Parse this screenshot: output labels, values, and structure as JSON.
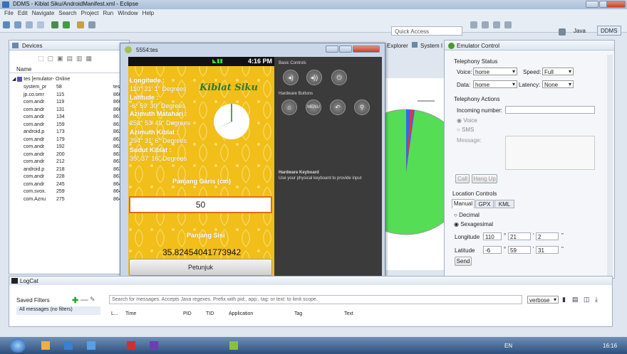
{
  "window": {
    "title": "DDMS - Kiblat Siku/AndroidManifest.xml - Eclipse"
  },
  "menu": [
    "File",
    "Edit",
    "Navigate",
    "Search",
    "Project",
    "Run",
    "Window",
    "Help"
  ],
  "toolbar": {
    "quick_access": "Quick Access",
    "perspectives": [
      "Java",
      "DDMS"
    ]
  },
  "devices": {
    "tab_label": "Devices",
    "col_name": "Name",
    "device": {
      "name": "tes [emulator-",
      "status": "Online"
    },
    "processes": [
      {
        "name": "system_pr",
        "pid": "58",
        "p": "tes"
      },
      {
        "name": "jp.co.omr",
        "pid": "115",
        "p": "860"
      },
      {
        "name": "com.andr",
        "pid": "119",
        "p": "860"
      },
      {
        "name": "com.andr",
        "pid": "131",
        "p": "860"
      },
      {
        "name": "com.andr",
        "pid": "134",
        "p": "861"
      },
      {
        "name": "com.andr",
        "pid": "159",
        "p": "861"
      },
      {
        "name": "android.p",
        "pid": "173",
        "p": "862"
      },
      {
        "name": "com.andr",
        "pid": "179",
        "p": "862"
      },
      {
        "name": "com.andr",
        "pid": "192",
        "p": "862"
      },
      {
        "name": "com.andr",
        "pid": "200",
        "p": "863"
      },
      {
        "name": "com.andr",
        "pid": "212",
        "p": "863"
      },
      {
        "name": "android.p",
        "pid": "218",
        "p": "863"
      },
      {
        "name": "com.andr",
        "pid": "228",
        "p": "863"
      },
      {
        "name": "com.andr",
        "pid": "245",
        "p": "864"
      },
      {
        "name": "com.svox.",
        "pid": "259",
        "p": "864"
      },
      {
        "name": "com.Aznu",
        "pid": "275",
        "p": "864"
      }
    ]
  },
  "emulator": {
    "title": "5554:tes",
    "time": "4:16 PM",
    "longitude_label": "Longitude :",
    "longitude_value": "110° 21' 1\" Degrees",
    "latitude_label": "Latitude :",
    "latitude_value": "-6° 59' 30\" Degrees",
    "azimuth_matahari_label": "Azimuth Matahari :",
    "azimuth_matahari_value": "258° 53' 49\" Degrees",
    "azimuth_kiblat_label": "Azimuth Kiblat :",
    "azimuth_kiblat_value": "294° 31' 6\" Degrees",
    "sudut_kiblat_label": "Sudut Kiblat :",
    "sudut_kiblat_value": "35° 37' 16\" Degrees",
    "logo_text": "Kiblat Siku",
    "panjang_garis_label": "Panjang Garis (cm)",
    "panjang_garis_value": "50",
    "panjang_sisi_label": "Panjang Sisi",
    "panjang_sisi_value": "35.82454041773942",
    "petunjuk_button": "Petunjuk",
    "basic_controls": "Basic Controls",
    "hardware_buttons": "Hardware Buttons",
    "menu_label": "MENU",
    "hw_keyboard_title": "Hardware Keyboard",
    "hw_keyboard_text": "Use your physical keyboard to provide input"
  },
  "file_explorer_tab": "Explorer",
  "system_tab": "System I",
  "emulator_control": {
    "tab_label": "Emulator Control",
    "telephony_status": "Telephony Status",
    "voice_label": "Voice:",
    "voice_value": "home",
    "speed_label": "Speed:",
    "speed_value": "Full",
    "data_label": "Data:",
    "data_value": "home",
    "latency_label": "Latency:",
    "latency_value": "None",
    "telephony_actions": "Telephony Actions",
    "incoming_label": "Incoming number:",
    "voice_radio": "Voice",
    "sms_radio": "SMS",
    "message_label": "Message:",
    "call_button": "Call",
    "hangup_button": "Hang Up",
    "location_controls": "Location Controls",
    "loc_tabs": [
      "Manual",
      "GPX",
      "KML"
    ],
    "decimal_radio": "Decimal",
    "sexagesimal_radio": "Sexagesimal",
    "longitude_label": "Longitude",
    "lon_deg": "110",
    "lon_min": "21",
    "lon_sec": "2",
    "latitude_label": "Latitude",
    "lat_deg": "-6",
    "lat_min": "59",
    "lat_sec": "31",
    "send_button": "Send"
  },
  "logcat": {
    "tab_label": "LogCat",
    "saved_filters": "Saved Filters",
    "all_messages": "All messages (no filters)",
    "search_placeholder": "Search for messages. Accepts Java regexes. Prefix with pid:, app:, tag: or text: to limit scope.",
    "level": "verbose",
    "columns": [
      "L...",
      "Time",
      "PID",
      "TID",
      "Application",
      "Tag",
      "Text"
    ]
  },
  "taskbar": {
    "lang": "EN",
    "clock": "16:16"
  }
}
